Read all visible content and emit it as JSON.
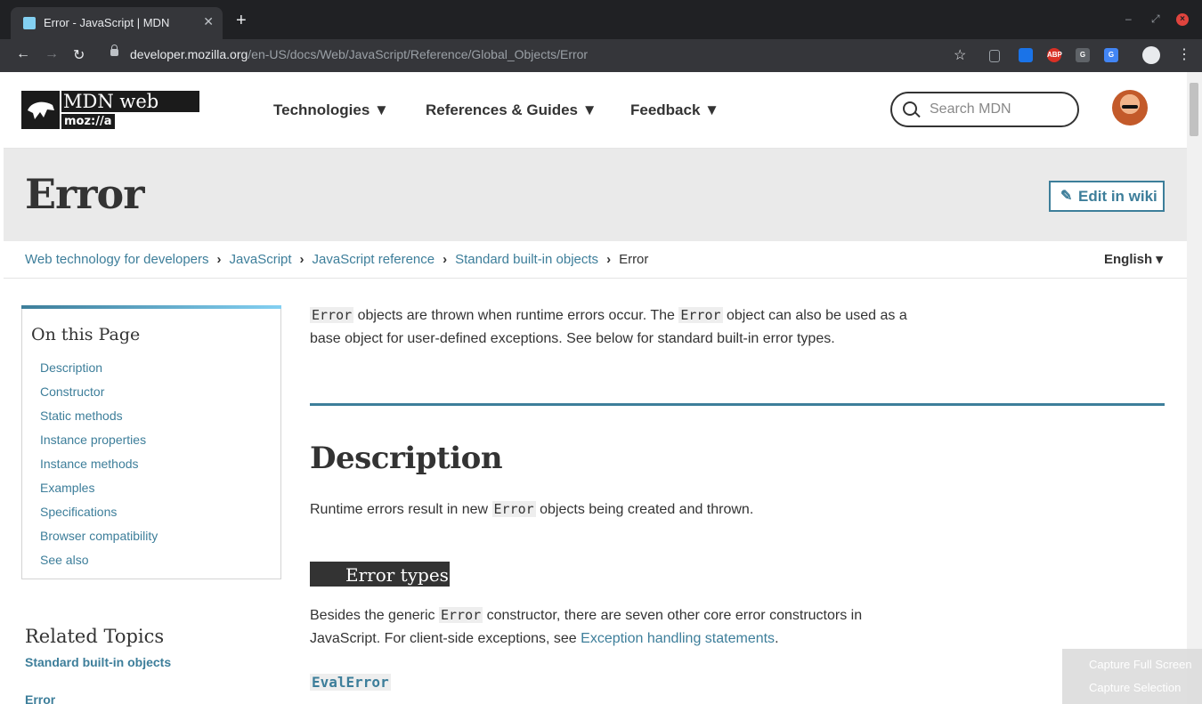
{
  "browser": {
    "tab_title": "Error - JavaScript | MDN",
    "tab_close": "✕",
    "new_tab": "+",
    "url_host": "developer.mozilla.org",
    "url_path": "/en-US/docs/Web/JavaScript/Reference/Global_Objects/Error",
    "extensions": [
      {
        "name": "ext-tabs-icon",
        "label": ""
      },
      {
        "name": "ext-translate-icon",
        "label": ""
      },
      {
        "name": "ext-adblock-icon",
        "label": "ABP"
      },
      {
        "name": "ext-g-icon",
        "label": "G"
      },
      {
        "name": "ext-google-translate-icon",
        "label": "G"
      }
    ]
  },
  "header": {
    "logo_word": "MDN web docs",
    "logo_moz": "moz://a",
    "nav": [
      "Technologies ▼",
      "References & Guides ▼",
      "Feedback ▼"
    ],
    "search_placeholder": "Search MDN"
  },
  "page": {
    "title": "Error",
    "edit_label": "Edit in wiki",
    "language": "English ▾",
    "breadcrumbs": [
      "Web technology for developers",
      "JavaScript",
      "JavaScript reference",
      "Standard built-in objects"
    ],
    "breadcrumb_current": "Error"
  },
  "toc": {
    "heading": "On this Page",
    "items": [
      "Description",
      "Constructor",
      "Static methods",
      "Instance properties",
      "Instance methods",
      "Examples",
      "Specifications",
      "Browser compatibility",
      "See also"
    ]
  },
  "related": {
    "heading": "Related Topics",
    "link1": "Standard built-in objects",
    "link2": "Error"
  },
  "content": {
    "intro_code1": "Error",
    "intro_text1": " objects are thrown when runtime errors occur. The ",
    "intro_code2": "Error",
    "intro_text2": " object can also be used as a base object for user-defined exceptions. See below for standard built-in error types.",
    "desc_heading": "Description",
    "desc_text1": "Runtime errors result in new ",
    "desc_code": "Error",
    "desc_text2": " objects being created and thrown.",
    "types_heading": "Error types",
    "types_text1": "Besides the generic ",
    "types_code": "Error",
    "types_text2": " constructor, there are seven other core error constructors in JavaScript. For client-side exceptions, see ",
    "types_link": "Exception handling statements",
    "types_text3": ".",
    "evalerror": "EvalError"
  },
  "overlay": {
    "full": "Capture Full Screen",
    "selection": "Capture Selection"
  },
  "colors": {
    "link": "#3d7e9a",
    "accent": "#83d0f2",
    "title_bg": "#eaeaea",
    "chrome_bg": "#202124"
  }
}
